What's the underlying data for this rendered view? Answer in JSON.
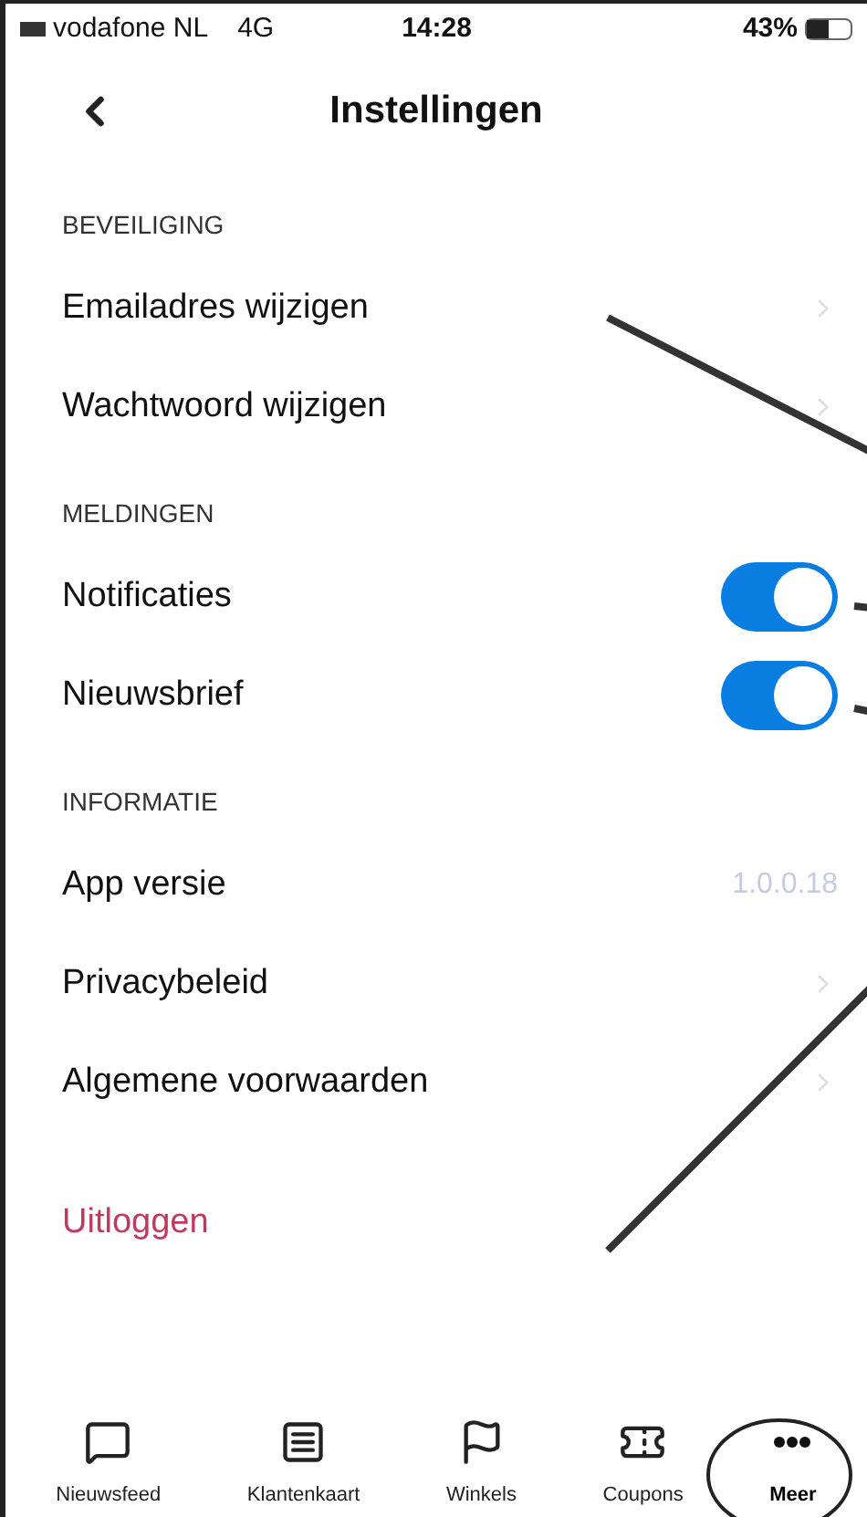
{
  "status_bar": {
    "carrier": "vodafone NL",
    "network": "4G",
    "time": "14:28",
    "battery": "43%"
  },
  "nav": {
    "title": "Instellingen"
  },
  "sections": [
    {
      "header": "BEVEILIGING",
      "rows": [
        {
          "kind": "link",
          "label": "Emailadres wijzigen"
        },
        {
          "kind": "link",
          "label": "Wachtwoord wijzigen"
        }
      ]
    },
    {
      "header": "MELDINGEN",
      "rows": [
        {
          "kind": "toggle",
          "label": "Notificaties",
          "on": true
        },
        {
          "kind": "toggle",
          "label": "Nieuwsbrief",
          "on": true
        }
      ]
    },
    {
      "header": "INFORMATIE",
      "rows": [
        {
          "kind": "value",
          "label": "App versie",
          "value": "1.0.0.18"
        },
        {
          "kind": "link",
          "label": "Privacybeleid"
        },
        {
          "kind": "link",
          "label": "Algemene voorwaarden"
        }
      ]
    }
  ],
  "logout": "Uitloggen",
  "tabs": [
    {
      "label": "Nieuwsfeed",
      "kind": "chat",
      "selected": false
    },
    {
      "label": "Klantenkaart",
      "kind": "card",
      "selected": false
    },
    {
      "label": "Winkels",
      "kind": "flag",
      "selected": false
    },
    {
      "label": "Coupons",
      "kind": "ticket",
      "selected": false
    },
    {
      "label": "Meer",
      "kind": "more",
      "selected": true
    }
  ]
}
